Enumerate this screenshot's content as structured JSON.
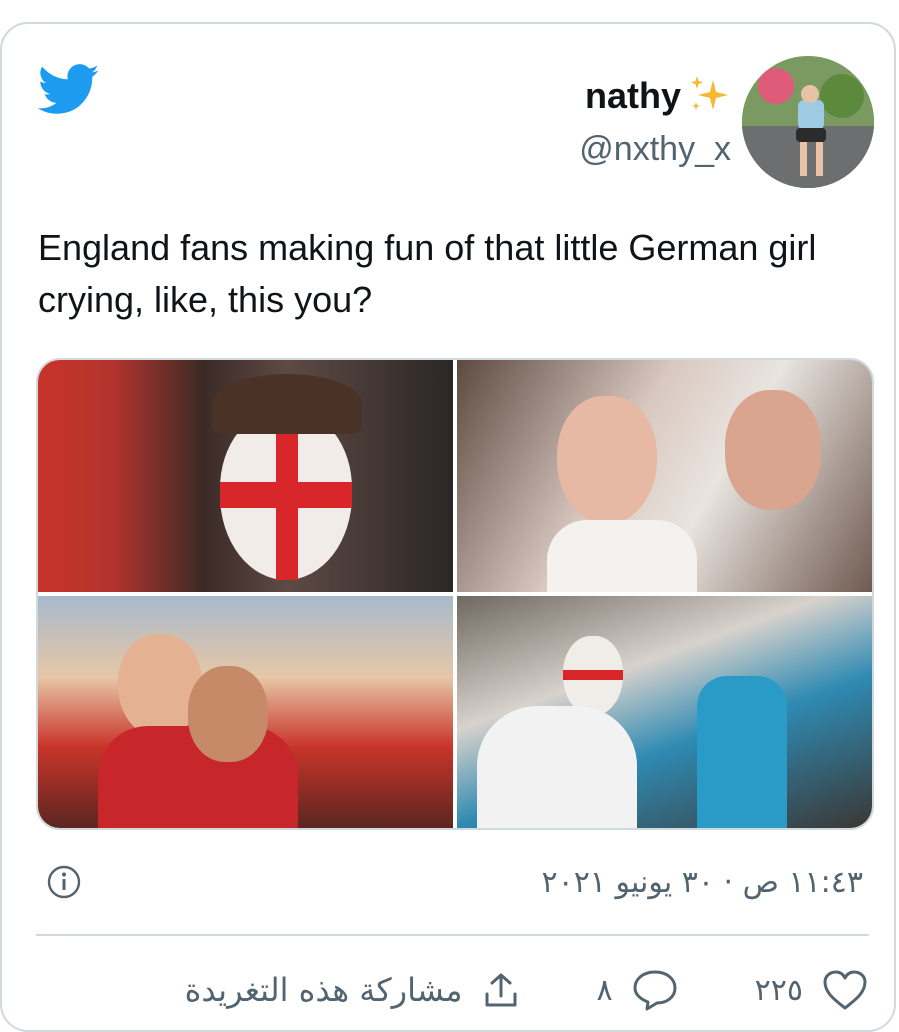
{
  "author": {
    "display_name": "nathy",
    "handle": "@nxthy_x",
    "sparkle_icon": "sparkles-emoji"
  },
  "tweet": {
    "text": "England fans making fun of that little German girl crying, like, this you?",
    "timestamp": "١١:٤٣ ص · ٣٠ يونيو ٢٠٢١"
  },
  "media": [
    {
      "icon": "photo-face-painted-fan"
    },
    {
      "icon": "photo-crying-fan-glasses"
    },
    {
      "icon": "photo-crying-women-hugging"
    },
    {
      "icon": "photo-painted-fan-consoling"
    }
  ],
  "actions": {
    "likes": "٢٢٥",
    "replies": "٨",
    "share_label": "مشاركة هذه التغريدة"
  },
  "colors": {
    "brand": "#1d9bf0",
    "text": "#0f1419",
    "muted": "#536471",
    "border": "#cfd9de",
    "gold": "#f5b82e"
  }
}
